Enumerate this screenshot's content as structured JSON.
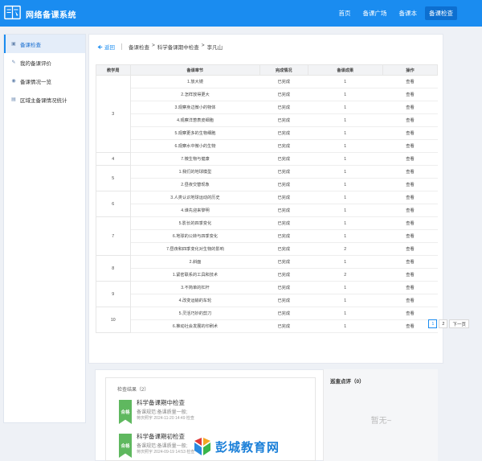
{
  "header": {
    "app_title": "网络备课系统",
    "nav": [
      {
        "label": "首页",
        "active": false
      },
      {
        "label": "备课广场",
        "active": false
      },
      {
        "label": "备课本",
        "active": false
      },
      {
        "label": "备课检查",
        "active": true
      }
    ]
  },
  "sidebar": {
    "items": [
      {
        "label": "备课检查",
        "icon": "monitor-icon",
        "active": true
      },
      {
        "label": "我的备课评价",
        "icon": "comment-icon",
        "active": false
      },
      {
        "label": "备课情况一览",
        "icon": "eye-icon",
        "active": false
      },
      {
        "label": "区域主备课情况统计",
        "icon": "chart-icon",
        "active": false
      }
    ]
  },
  "breadcrumb": {
    "back": "返回",
    "path": [
      "备课检查",
      ">",
      "科学备课期中检查",
      ">",
      "李凡山"
    ]
  },
  "table": {
    "headers": [
      "教学周",
      "备课章节",
      "完成情况",
      "备课成果",
      "操作"
    ],
    "groups": [
      {
        "week": "3",
        "rows": [
          {
            "chapter": "1.放大镜",
            "status": "已完成",
            "count": "1",
            "action": "查看"
          },
          {
            "chapter": "2.怎样放得更大",
            "status": "已完成",
            "count": "1",
            "action": "查看"
          },
          {
            "chapter": "3.观察身边微小的物体",
            "status": "已完成",
            "count": "1",
            "action": "查看"
          },
          {
            "chapter": "4.观察洋葱表皮细胞",
            "status": "已完成",
            "count": "1",
            "action": "查看"
          },
          {
            "chapter": "5.观察更多的生物细胞",
            "status": "已完成",
            "count": "1",
            "action": "查看"
          },
          {
            "chapter": "6.观察水中微小的生物",
            "status": "已完成",
            "count": "1",
            "action": "查看"
          }
        ]
      },
      {
        "week": "4",
        "rows": [
          {
            "chapter": "7.微生物与健康",
            "status": "已完成",
            "count": "1",
            "action": "查看"
          }
        ]
      },
      {
        "week": "5",
        "rows": [
          {
            "chapter": "1.我们的地球模型",
            "status": "已完成",
            "count": "1",
            "action": "查看"
          },
          {
            "chapter": "2.昼夜交替现象",
            "status": "已完成",
            "count": "1",
            "action": "查看"
          }
        ]
      },
      {
        "week": "6",
        "rows": [
          {
            "chapter": "3.人类认识地球运动的历史",
            "status": "已完成",
            "count": "1",
            "action": "查看"
          },
          {
            "chapter": "4.谁先迎来黎明",
            "status": "已完成",
            "count": "1",
            "action": "查看"
          }
        ]
      },
      {
        "week": "7",
        "rows": [
          {
            "chapter": "5.影长的四季变化",
            "status": "已完成",
            "count": "1",
            "action": "查看"
          },
          {
            "chapter": "6.地球的公转与四季变化",
            "status": "已完成",
            "count": "1",
            "action": "查看"
          },
          {
            "chapter": "7.昼夜和四季变化对生物的影响",
            "status": "已完成",
            "count": "2",
            "action": "查看"
          }
        ]
      },
      {
        "week": "8",
        "rows": [
          {
            "chapter": "2.斜面",
            "status": "已完成",
            "count": "1",
            "action": "查看"
          },
          {
            "chapter": "1.紧密联系的工具和技术",
            "status": "已完成",
            "count": "2",
            "action": "查看"
          }
        ]
      },
      {
        "week": "9",
        "rows": [
          {
            "chapter": "3.不简单的杠杆",
            "status": "已完成",
            "count": "1",
            "action": "查看"
          },
          {
            "chapter": "4.改变运输的车轮",
            "status": "已完成",
            "count": "1",
            "action": "查看"
          }
        ]
      },
      {
        "week": "10",
        "rows": [
          {
            "chapter": "5.灵活巧妙的剪刀",
            "status": "已完成",
            "count": "1",
            "action": "查看"
          },
          {
            "chapter": "6.推动社会发展的印刷术",
            "status": "已完成",
            "count": "1",
            "action": "查看"
          }
        ]
      }
    ]
  },
  "pagination": {
    "pages": [
      "1",
      "2"
    ],
    "current": "1",
    "next": "下一页"
  },
  "check_results": {
    "title": "检查结果（2）",
    "items": [
      {
        "badge": "合格",
        "name": "科学备课期中检查",
        "grade": "备课规范:备课质量一般;",
        "meta": "蒋庆照宇 2024-11-20 14:49 检查"
      },
      {
        "badge": "合格",
        "name": "科学备课期初检查",
        "grade": "备课规范:备课质量一般;",
        "meta": "蒋庆照宇 2024-09-19 14:53 检查"
      }
    ]
  },
  "inspection": {
    "title": "巡查点评（0）",
    "empty": "暂无~"
  },
  "watermark": {
    "text": "彭城教育网"
  },
  "colors": {
    "header_bg": "#1a8cf0",
    "badge_green": "#5fb85f",
    "accent": "#1a8cf0"
  }
}
